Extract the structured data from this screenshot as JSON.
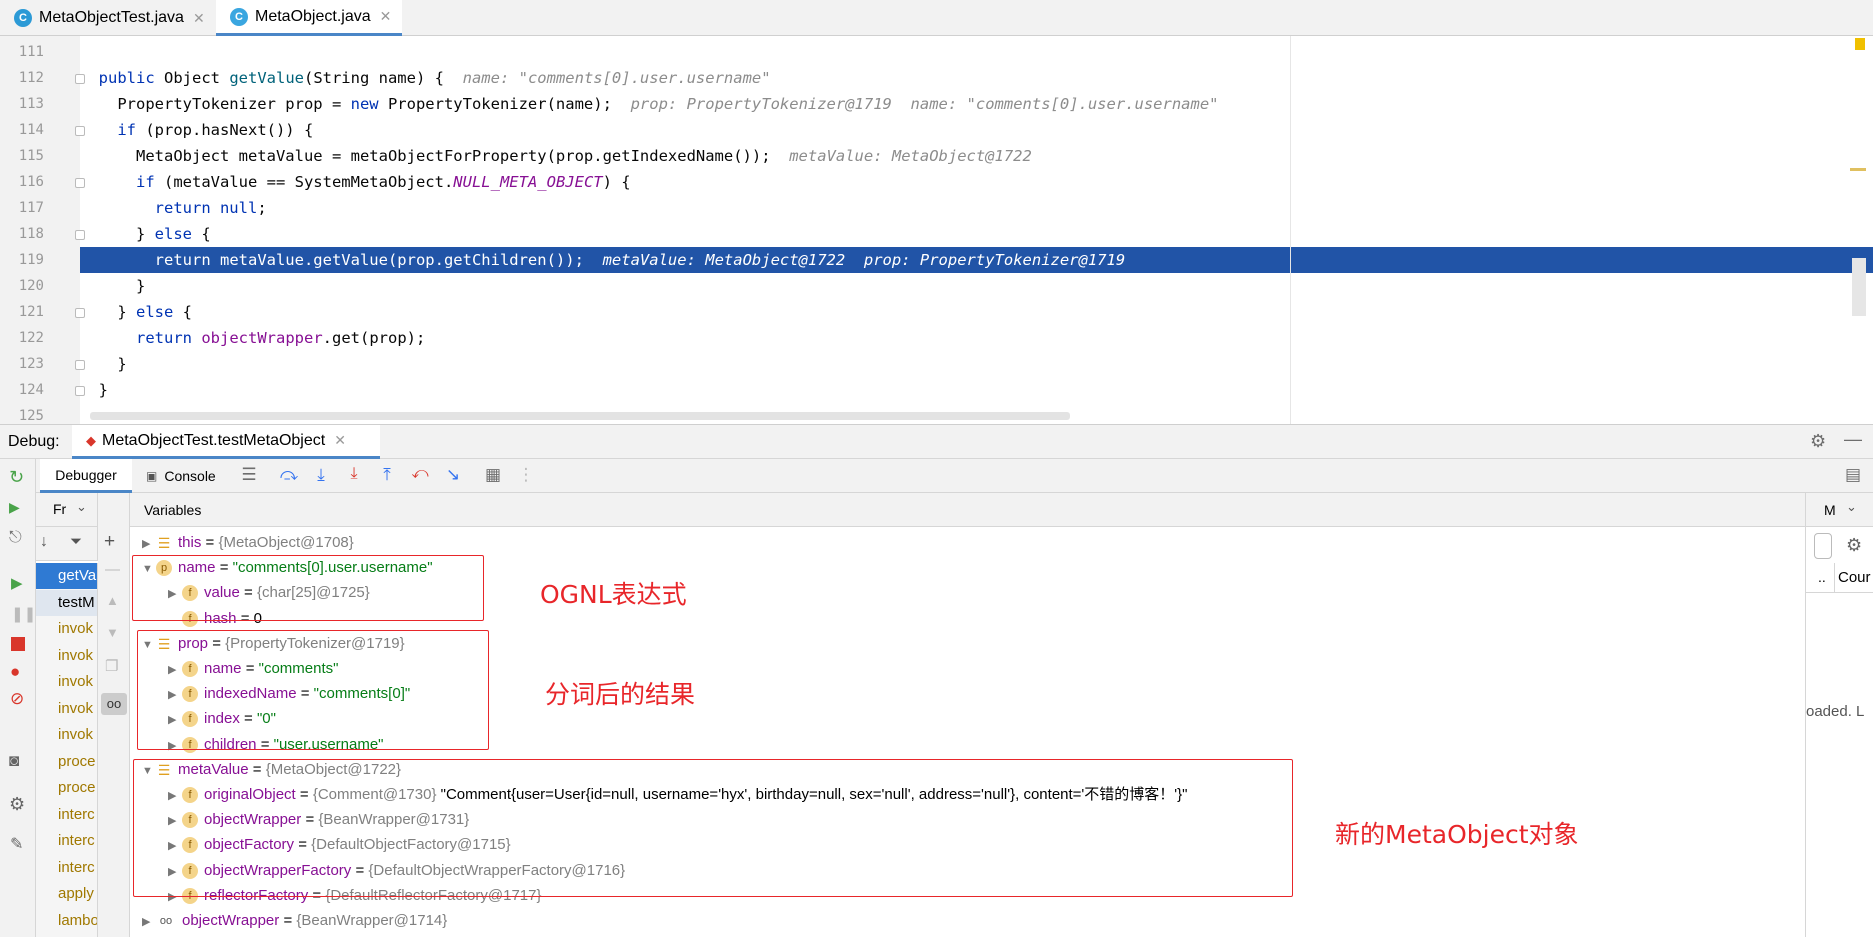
{
  "tabs": [
    {
      "label": "MetaObjectTest.java",
      "active": false
    },
    {
      "label": "MetaObject.java",
      "active": true
    }
  ],
  "editor": {
    "lines": [
      {
        "n": "111",
        "html": ""
      },
      {
        "n": "112",
        "html": "  <span class='kw'>public</span> Object <span class='m'>getValue</span>(String name) {  <span class='hint'>name: \"comments[0].user.username\"</span>"
      },
      {
        "n": "113",
        "html": "    PropertyTokenizer prop = <span class='kw'>new</span> PropertyTokenizer(name);  <span class='hint'>prop: PropertyTokenizer@1719  name: \"comments[0].user.username\"</span>"
      },
      {
        "n": "114",
        "html": "    <span class='kw'>if</span> (prop.hasNext()) {"
      },
      {
        "n": "115",
        "html": "      MetaObject metaValue = metaObjectForProperty(prop.getIndexedName());  <span class='hint'>metaValue: MetaObject@1722</span>"
      },
      {
        "n": "116",
        "html": "      <span class='kw'>if</span> (metaValue == SystemMetaObject.<span class='fld'>NULL_META_OBJECT</span>) {"
      },
      {
        "n": "117",
        "html": "        <span class='kw'>return null</span>;"
      },
      {
        "n": "118",
        "html": "      } <span class='kw'>else</span> {"
      },
      {
        "n": "119",
        "html": "        <span class='kw'>return</span> metaValue.getValue(prop.getChildren());  <span class='hint'>metaValue: MetaObject@1722  prop: PropertyTokenizer@1719</span>",
        "hl": true
      },
      {
        "n": "120",
        "html": "      }"
      },
      {
        "n": "121",
        "html": "    } <span class='kw'>else</span> {"
      },
      {
        "n": "122",
        "html": "      <span class='kw'>return</span> <span class='fld2'>objectWrapper</span>.get(prop);"
      },
      {
        "n": "123",
        "html": "    }"
      },
      {
        "n": "124",
        "html": "  }"
      },
      {
        "n": "125",
        "html": ""
      }
    ]
  },
  "debug": {
    "label": "Debug:",
    "session": "MetaObjectTest.testMetaObject",
    "debugger_tab": "Debugger",
    "console_tab": "Console",
    "frames_header": "Fr",
    "vars_header": "Variables",
    "right_header": "M",
    "right_col": "Cour",
    "right_row": "..",
    "loaded_text": "oaded. L"
  },
  "frames": [
    "getVa",
    "testM",
    "invok",
    "invok",
    "invok",
    "invok",
    "invok",
    "proce",
    "proce",
    "interc",
    "interc",
    "interc",
    "apply",
    "lambo"
  ],
  "variables": [
    {
      "indent": 0,
      "arrow": "▶",
      "icon": "list",
      "name": "this",
      "eq": " = ",
      "gray": "{MetaObject@1708}",
      "str": ""
    },
    {
      "indent": 0,
      "arrow": "▼",
      "icon": "p",
      "name": "name",
      "eq": " = ",
      "gray": "",
      "str": "\"comments[0].user.username\""
    },
    {
      "indent": 1,
      "arrow": "▶",
      "icon": "f",
      "name": "value",
      "eq": " = ",
      "gray": "{char[25]@1725}",
      "str": ""
    },
    {
      "indent": 1,
      "arrow": "",
      "icon": "f",
      "name": "hash",
      "eq": " = 0",
      "gray": "",
      "str": ""
    },
    {
      "indent": 0,
      "arrow": "▼",
      "icon": "list",
      "name": "prop",
      "eq": " = ",
      "gray": "{PropertyTokenizer@1719}",
      "str": ""
    },
    {
      "indent": 1,
      "arrow": "▶",
      "icon": "f",
      "name": "name",
      "eq": " = ",
      "gray": "",
      "str": "\"comments\""
    },
    {
      "indent": 1,
      "arrow": "▶",
      "icon": "f",
      "name": "indexedName",
      "eq": " = ",
      "gray": "",
      "str": "\"comments[0]\""
    },
    {
      "indent": 1,
      "arrow": "▶",
      "icon": "f",
      "name": "index",
      "eq": " = ",
      "gray": "",
      "str": "\"0\""
    },
    {
      "indent": 1,
      "arrow": "▶",
      "icon": "f",
      "name": "children",
      "eq": " = ",
      "gray": "",
      "str": "\"user.username\""
    },
    {
      "indent": 0,
      "arrow": "▼",
      "icon": "list",
      "name": "metaValue",
      "eq": " = ",
      "gray": "{MetaObject@1722}",
      "str": ""
    },
    {
      "indent": 1,
      "arrow": "▶",
      "icon": "f",
      "name": "originalObject",
      "eq": " = ",
      "gray": "{Comment@1730} ",
      "str": "\"Comment{user=User{id=null, username='hyx', birthday=null, sex='null', address='null'}, content='不错的博客！'}\"",
      "black": true
    },
    {
      "indent": 1,
      "arrow": "▶",
      "icon": "f",
      "name": "objectWrapper",
      "eq": " = ",
      "gray": "{BeanWrapper@1731}",
      "str": ""
    },
    {
      "indent": 1,
      "arrow": "▶",
      "icon": "f",
      "name": "objectFactory",
      "eq": " = ",
      "gray": "{DefaultObjectFactory@1715}",
      "str": ""
    },
    {
      "indent": 1,
      "arrow": "▶",
      "icon": "f",
      "name": "objectWrapperFactory",
      "eq": " = ",
      "gray": "{DefaultObjectWrapperFactory@1716}",
      "str": ""
    },
    {
      "indent": 1,
      "arrow": "▶",
      "icon": "f",
      "name": "reflectorFactory",
      "eq": " = ",
      "gray": "{DefaultReflectorFactory@1717}",
      "str": ""
    },
    {
      "indent": 0,
      "arrow": "▶",
      "icon": "oo",
      "name": "objectWrapper",
      "eq": " = ",
      "gray": "{BeanWrapper@1714}",
      "str": ""
    }
  ],
  "annotations": {
    "ognl": "OGNL表达式",
    "tokenized": "分词后的结果",
    "newmeta": "新的MetaObject对象"
  },
  "colors": {
    "highlight": "#2154a7",
    "annotation": "#e8262a",
    "selected_frame": "#2f7ad3"
  }
}
